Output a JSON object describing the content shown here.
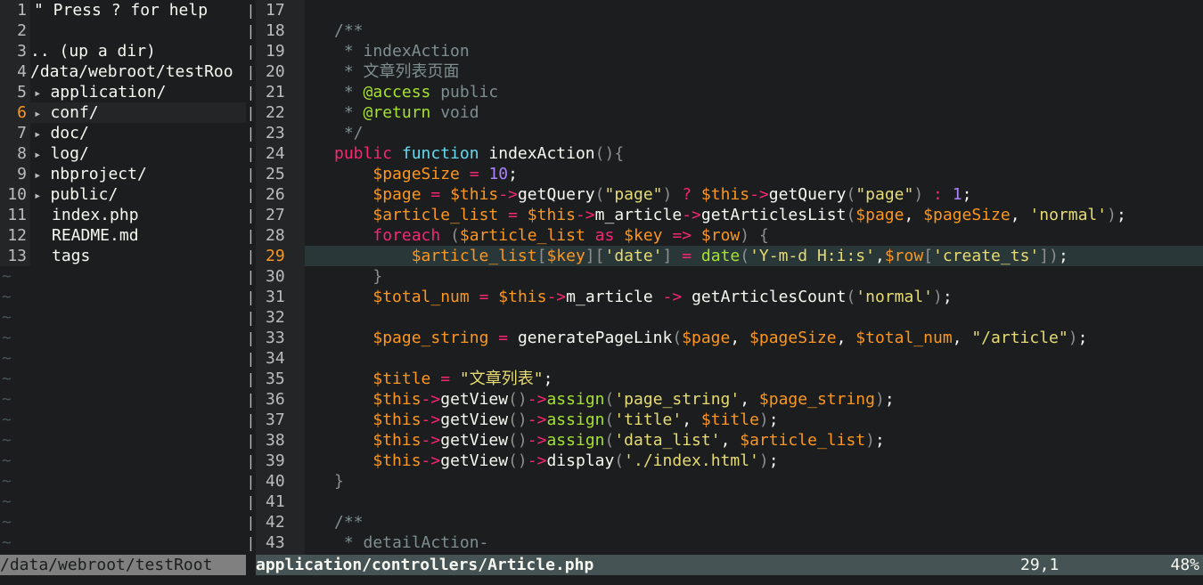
{
  "tree": {
    "header": "\" Press ? for help",
    "updir": ".. (up a dir)",
    "root": "/data/webroot/testRoo",
    "items": [
      {
        "name": "application/",
        "dir": true
      },
      {
        "name": "conf/",
        "dir": true
      },
      {
        "name": "doc/",
        "dir": true
      },
      {
        "name": "log/",
        "dir": true
      },
      {
        "name": "nbproject/",
        "dir": true
      },
      {
        "name": "public/",
        "dir": true
      },
      {
        "name": "index.php",
        "dir": false
      },
      {
        "name": "README.md",
        "dir": false
      },
      {
        "name": "tags",
        "dir": false
      }
    ],
    "line_numbers": [
      "1",
      "2",
      "3",
      "4",
      "5",
      "6",
      "7",
      "8",
      "9",
      "10",
      "11",
      "12",
      "13"
    ],
    "cursor_line": "6",
    "tilde": "~"
  },
  "editor": {
    "line_numbers": [
      "17",
      "18",
      "19",
      "20",
      "21",
      "22",
      "23",
      "24",
      "25",
      "26",
      "27",
      "28",
      "29",
      "30",
      "31",
      "32",
      "33",
      "34",
      "35",
      "36",
      "37",
      "38",
      "39",
      "40",
      "41",
      "42",
      "43"
    ],
    "cursor_line": "29"
  },
  "status": {
    "left_path": "/data/webroot/testRoot",
    "right_file": "application/controllers/Article.php",
    "position": "29,1",
    "percent": "48%"
  },
  "colors": {
    "background": "#1b1d1e",
    "gutter": "#232526",
    "cursor_line": "#293739",
    "keyword": "#f92672",
    "type": "#66d9ef",
    "variable": "#fd971f",
    "string": "#e6db74",
    "number": "#ae81ff",
    "doc_tag": "#a6e22e",
    "comment": "#7e8e91"
  }
}
